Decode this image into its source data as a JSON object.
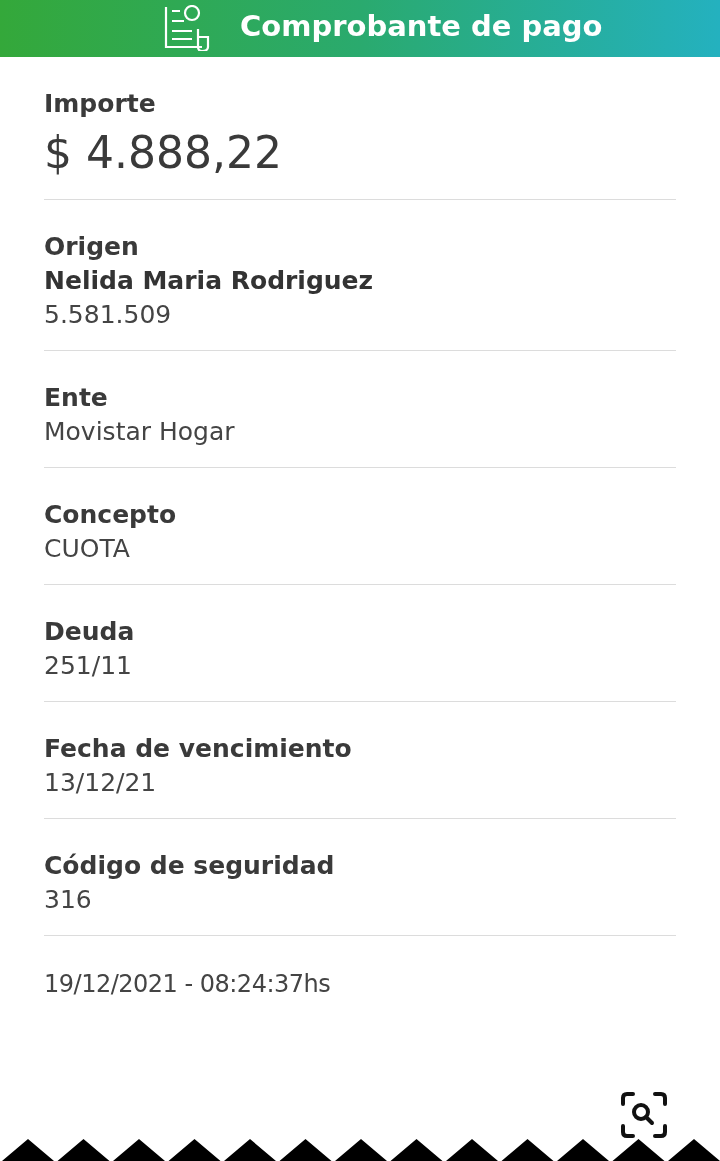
{
  "header": {
    "title": "Comprobante de pago"
  },
  "amount": {
    "label": "Importe",
    "value": "$ 4.888,22"
  },
  "fields": [
    {
      "label": "Origen",
      "values": [
        "Nelida Maria Rodriguez",
        "5.581.509"
      ]
    },
    {
      "label": "Ente",
      "values": [
        "Movistar Hogar"
      ]
    },
    {
      "label": "Concepto",
      "values": [
        "CUOTA"
      ]
    },
    {
      "label": "Deuda",
      "values": [
        "251/11"
      ]
    },
    {
      "label": "Fecha de vencimiento",
      "values": [
        "13/12/21"
      ]
    },
    {
      "label": "Código de seguridad",
      "values": [
        "316"
      ]
    }
  ],
  "timestamp": "19/12/2021 - 08:24:37hs"
}
